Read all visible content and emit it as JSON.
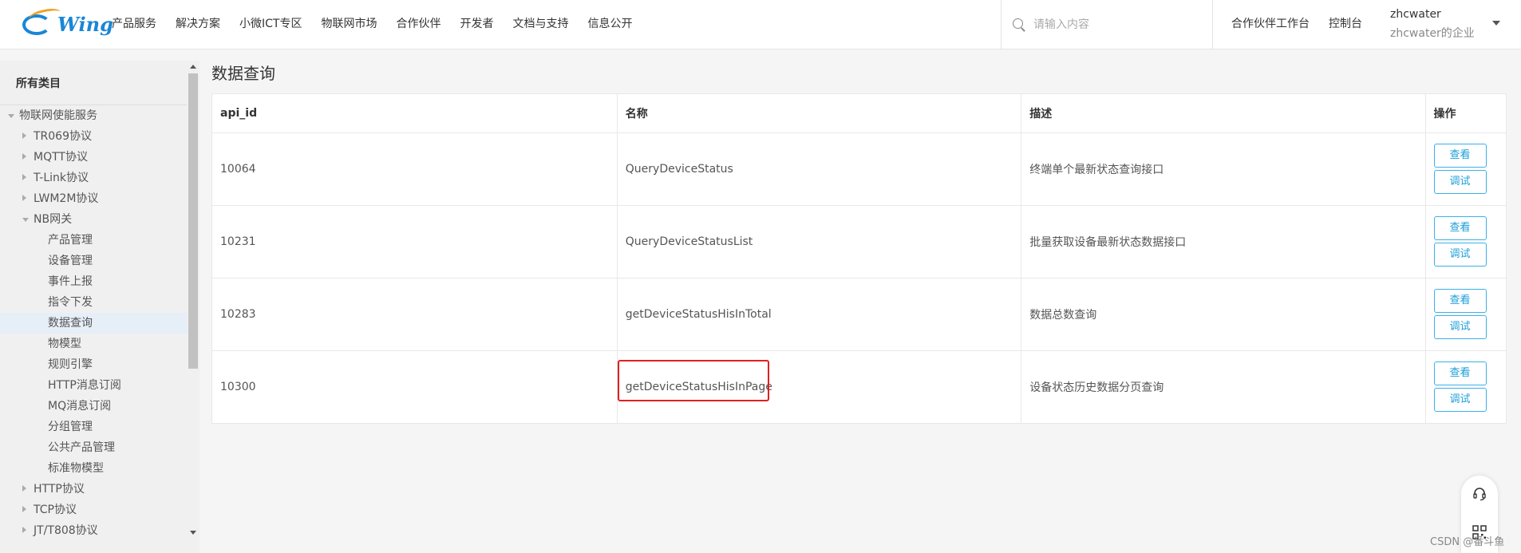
{
  "header": {
    "logo_text": "Wing",
    "nav": [
      "产品服务",
      "解决方案",
      "小微ICT专区",
      "物联网市场",
      "合作伙伴",
      "开发者",
      "文档与支持",
      "信息公开"
    ],
    "search_placeholder": "请输入内容",
    "right_links": [
      "合作伙伴工作台",
      "控制台"
    ],
    "user_name": "zhcwater",
    "user_enterprise": "zhcwater的企业"
  },
  "sidebar": {
    "title": "所有类目",
    "items": [
      {
        "label": "物联网使能服务",
        "level": 0,
        "expanded": true
      },
      {
        "label": "TR069协议",
        "level": 1,
        "expanded": false
      },
      {
        "label": "MQTT协议",
        "level": 1,
        "expanded": false
      },
      {
        "label": "T-Link协议",
        "level": 1,
        "expanded": false
      },
      {
        "label": "LWM2M协议",
        "level": 1,
        "expanded": false
      },
      {
        "label": "NB网关",
        "level": 1,
        "expanded": true
      },
      {
        "label": "产品管理",
        "level": 2
      },
      {
        "label": "设备管理",
        "level": 2
      },
      {
        "label": "事件上报",
        "level": 2
      },
      {
        "label": "指令下发",
        "level": 2
      },
      {
        "label": "数据查询",
        "level": 2,
        "active": true
      },
      {
        "label": "物模型",
        "level": 2
      },
      {
        "label": "规则引擎",
        "level": 2
      },
      {
        "label": "HTTP消息订阅",
        "level": 2
      },
      {
        "label": "MQ消息订阅",
        "level": 2
      },
      {
        "label": "分组管理",
        "level": 2
      },
      {
        "label": "公共产品管理",
        "level": 2
      },
      {
        "label": "标准物模型",
        "level": 2
      },
      {
        "label": "HTTP协议",
        "level": 1,
        "expanded": false
      },
      {
        "label": "TCP协议",
        "level": 1,
        "expanded": false
      },
      {
        "label": "JT/T808协议",
        "level": 1,
        "expanded": false
      }
    ]
  },
  "main": {
    "title": "数据查询",
    "columns": [
      "api_id",
      "名称",
      "描述",
      "操作"
    ],
    "rows": [
      {
        "api_id": "10064",
        "name": "QueryDeviceStatus",
        "desc": "终端单个最新状态查询接口"
      },
      {
        "api_id": "10231",
        "name": "QueryDeviceStatusList",
        "desc": "批量获取设备最新状态数据接口"
      },
      {
        "api_id": "10283",
        "name": "getDeviceStatusHisInTotal",
        "desc": "数据总数查询"
      },
      {
        "api_id": "10300",
        "name": "getDeviceStatusHisInPage",
        "desc": "设备状态历史数据分页查询",
        "highlighted": true
      }
    ],
    "view_label": "查看",
    "debug_label": "调试"
  },
  "watermark": "CSDN @番斗鱼",
  "colors": {
    "accent": "#1a9ed9",
    "highlight": "#e02020",
    "active_bg": "#e6eef8"
  }
}
